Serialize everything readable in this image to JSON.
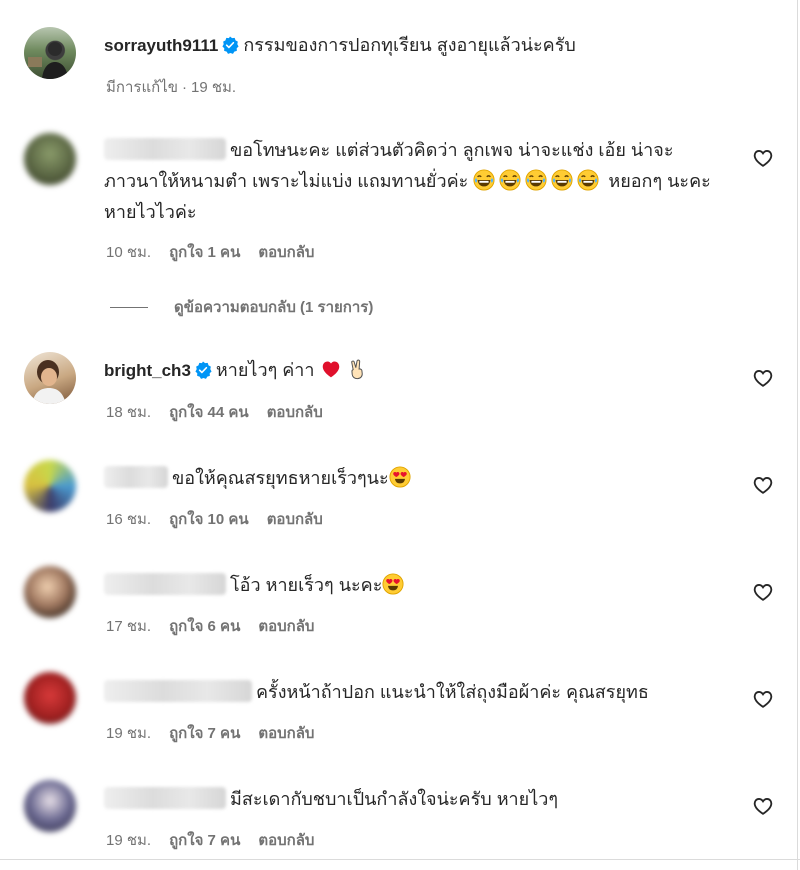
{
  "caption": {
    "username": "sorrayuth9111",
    "text": "กรรมของการปอกทุเรียน สูงอายุแล้วน่ะครับ",
    "edited": "มีการแก้ไข",
    "separator": "·",
    "time": "19 ชม."
  },
  "view_replies": "ดูข้อความตอบกลับ (1 รายการ)",
  "reply_label": "ตอบกลับ",
  "comments": [
    {
      "text": "ขอโทษนะคะ แต่ส่วนตัวคิดว่า ลูกเพจ น่าจะแช่ง เอ้ย น่าจะ ภาวนาให้หนามตำ เพราะไม่แบ่ง แถมทานยั่วค่ะ",
      "text2": "หยอกๆ นะคะ หายไวไวค่ะ",
      "time": "10 ชม.",
      "likes": "ถูกใจ 1 คน"
    },
    {
      "username": "bright_ch3",
      "text": "หายไวๆ ค่าา",
      "time": "18 ชม.",
      "likes": "ถูกใจ 44 คน"
    },
    {
      "text": "ขอให้คุณสรยุทธหายเร็วๆนะ",
      "time": "16 ชม.",
      "likes": "ถูกใจ 10 คน"
    },
    {
      "text": "โอ้ว หายเร็วๆ นะคะ",
      "time": "17 ชม.",
      "likes": "ถูกใจ 6 คน"
    },
    {
      "text": "ครั้งหน้าถ้าปอก แนะนำให้ใส่ถุงมือผ้าค่ะ คุณสรยุทธ",
      "time": "19 ชม.",
      "likes": "ถูกใจ 7 คน"
    },
    {
      "text": "มีสะเดากับชบาเป็นกำลังใจน่ะครับ หายไวๆ",
      "time": "19 ชม.",
      "likes": "ถูกใจ 7 คน"
    }
  ],
  "icons": {
    "verified": "verified-badge-icon",
    "heart": "heart-outline-icon",
    "emoji_laugh": "tears-of-joy-emoji",
    "emoji_heart_eyes": "heart-eyes-emoji",
    "emoji_red_heart": "red-heart-emoji",
    "emoji_peace": "victory-hand-emoji"
  },
  "colors": {
    "verified": "#0095f6",
    "text": "#262626",
    "meta": "#737373"
  }
}
